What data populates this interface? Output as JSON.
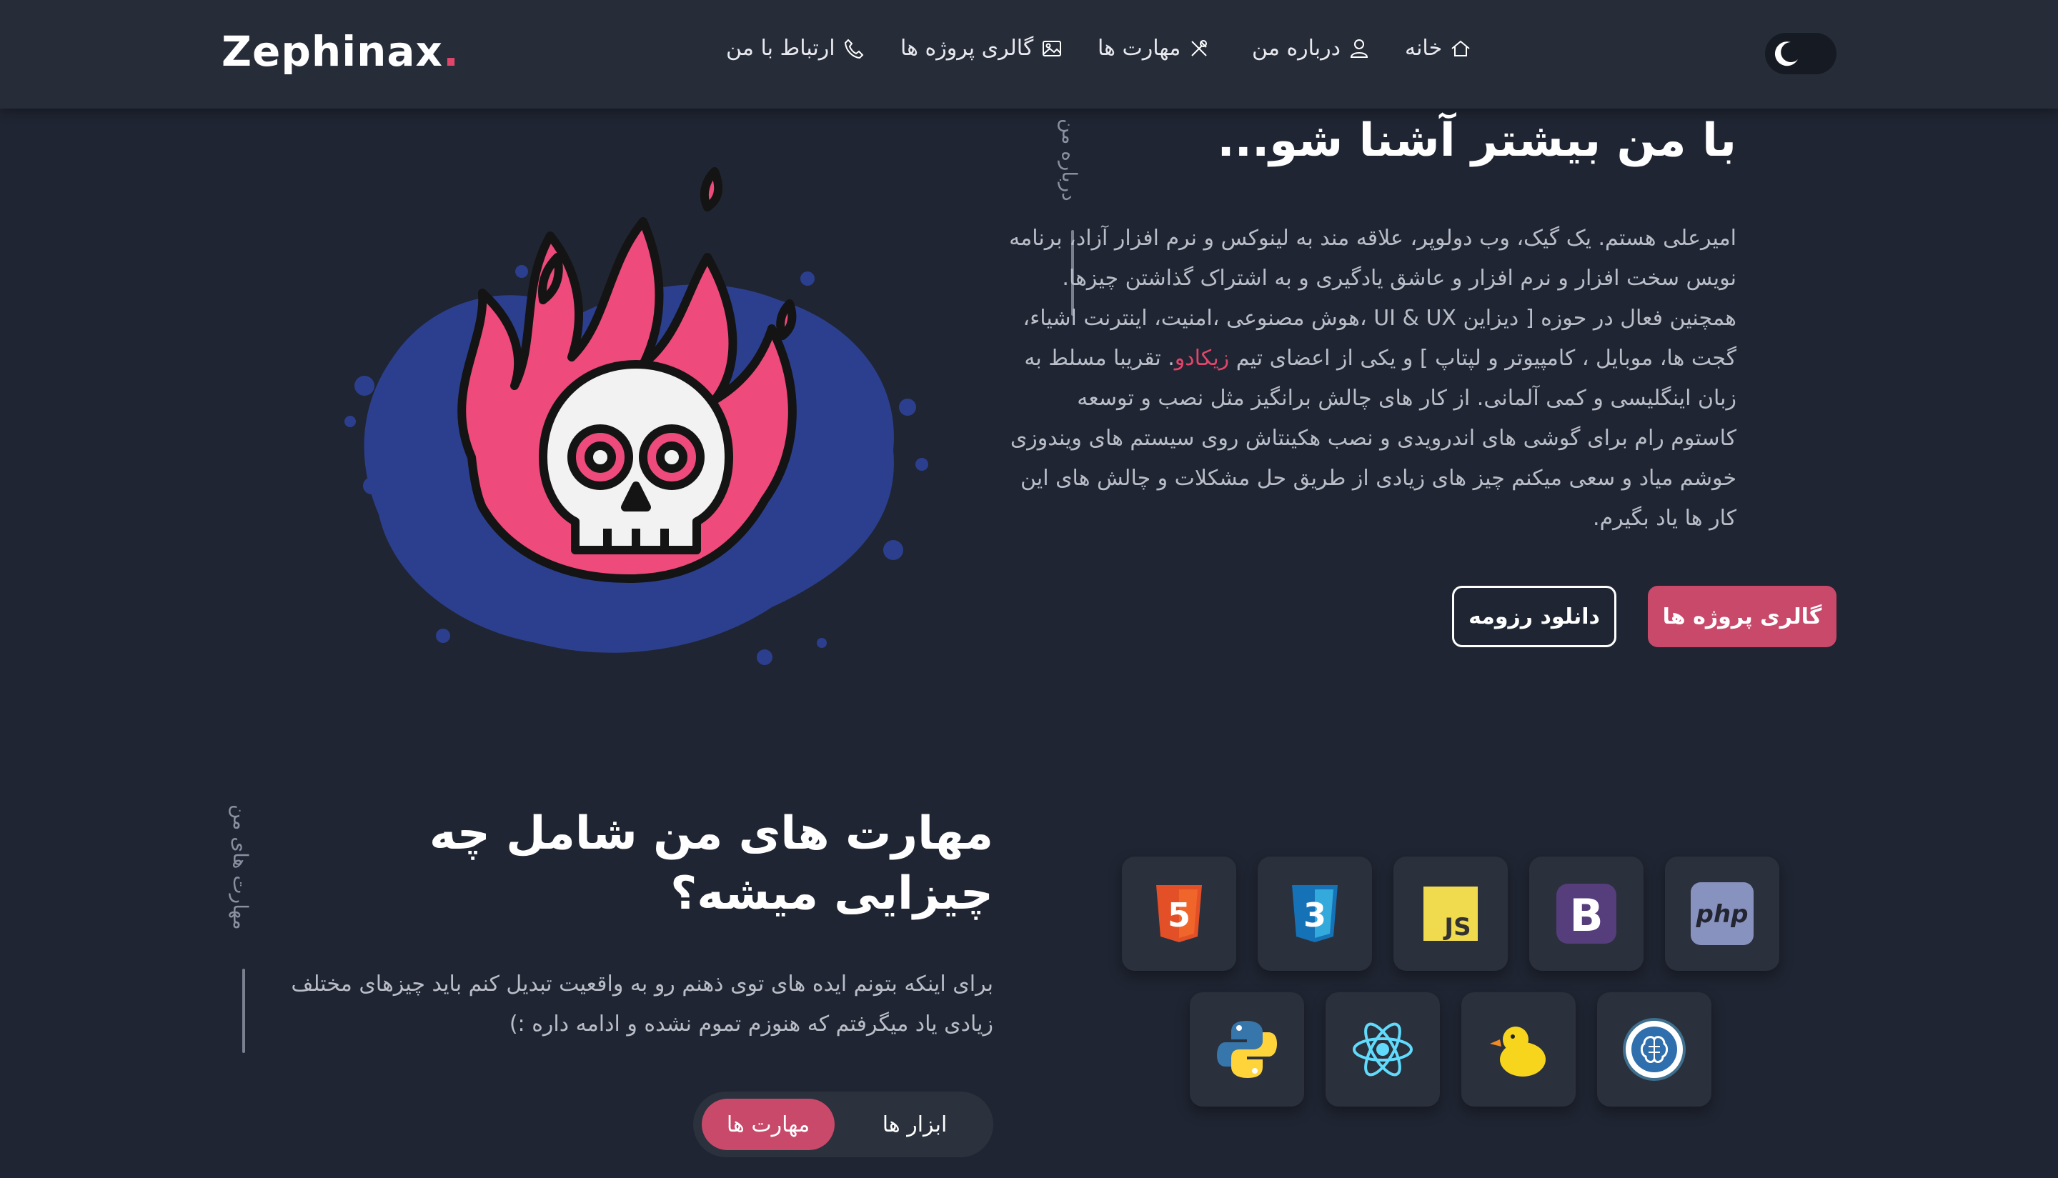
{
  "header": {
    "logo_text": "Zephinax",
    "logo_dot": ".",
    "nav": [
      {
        "label": "خانه",
        "icon": "home-icon"
      },
      {
        "label": "درباره من",
        "icon": "user-icon"
      },
      {
        "label": "مهارت ها",
        "icon": "tools-icon"
      },
      {
        "label": "گالری پروژه ها",
        "icon": "gallery-icon"
      },
      {
        "label": "ارتباط با من",
        "icon": "phone-icon"
      }
    ],
    "theme_toggle_icon": "moon-icon"
  },
  "about": {
    "side_label": "درباره من",
    "title": "با من بیشتر آشنا شو...",
    "text_before": "امیرعلی هستم. یک گیک، وب دولوپر، علاقه مند به لینوکس و نرم افزار آزاد، برنامه نویس سخت افزار و نرم افزار و عاشق یادگیری و به اشتراک گذاشتن چیزها. همچنین فعال در حوزه [ دیزاین UI & UX ،هوش مصنوعی ،امنیت، اینترنت اشیاء، گجت ها، موبایل ، کامپیوتر و لپتاپ ] و یکی از اعضای تیم ",
    "text_link": "زیکادو",
    "text_after": ". تقریبا مسلط به زبان اینگلیسی و کمی آلمانی. از کار های چالش برانگیز مثل نصب و توسعه کاستوم رام برای گوشی های اندرویدی و نصب هکینتاش روی سیستم های ویندوزی خوشم میاد و سعی میکنم چیز های زیادی از طریق حل مشکلات و چالش های این کار ها یاد بگیرم.",
    "btn_gallery": "گالری پروژه ها",
    "btn_resume": "دانلود رزومه",
    "hero_image": "flaming-skull-illustration"
  },
  "skills": {
    "side_label": "مهارت های من",
    "title": "مهارت های من شامل چه چیزایی میشه؟",
    "text": "برای اینکه بتونم ایده های توی ذهنم رو به واقعیت تبدیل کنم باید چیزهای مختلف زیادی یاد میگرفتم که هنوزم تموم نشده و ادامه داره :)",
    "tab_active": "مهارت ها",
    "tab_inactive": "ابزار ها",
    "icons": [
      "html5-icon",
      "css3-icon",
      "javascript-icon",
      "bootstrap-icon",
      "php-icon",
      "python-icon",
      "react-icon",
      "duck-icon",
      "ai-brain-icon"
    ],
    "icon_text": {
      "js": "JS",
      "bootstrap": "B",
      "php": "php",
      "html": "5",
      "css": "3"
    }
  },
  "colors": {
    "accent": "#e0466b",
    "button": "#c8496a",
    "background": "#1f2532",
    "header": "#262c38"
  }
}
